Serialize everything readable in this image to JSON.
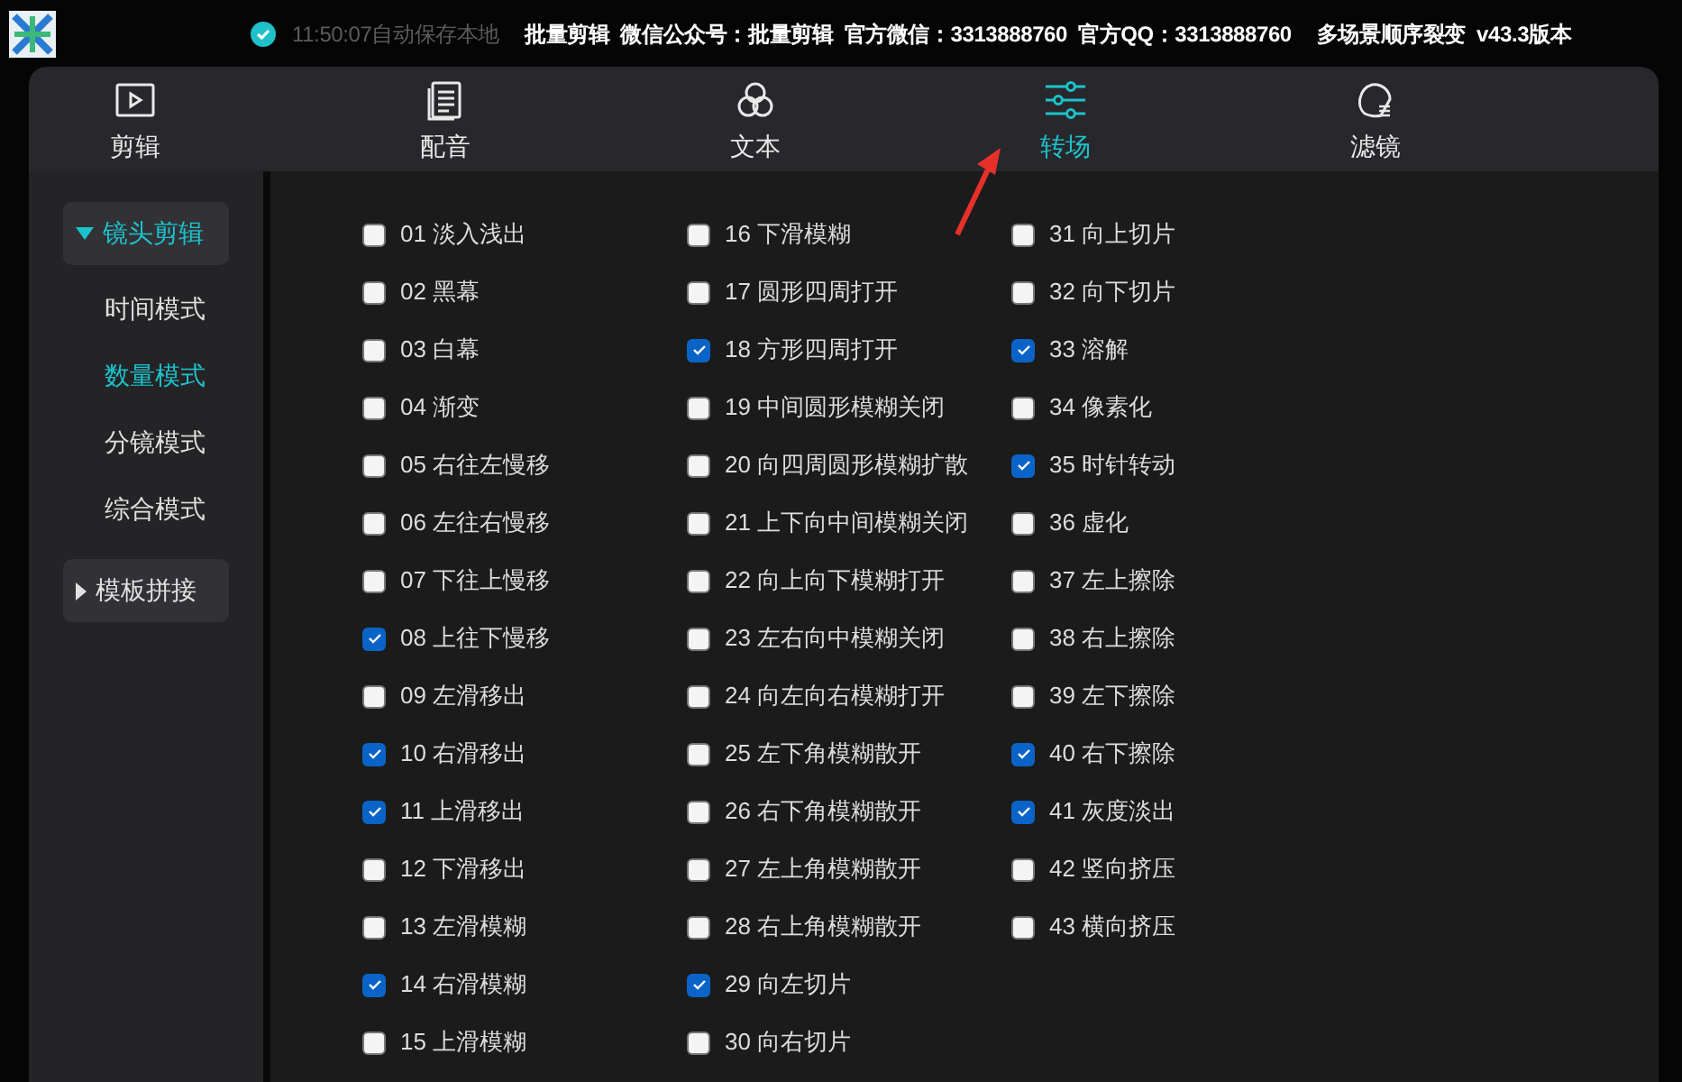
{
  "top_bar": {
    "save_status": "11:50:07自动保存本地",
    "info": [
      "批量剪辑",
      "微信公众号：批量剪辑",
      "官方微信：3313888760",
      "官方QQ：3313888760",
      "多场景顺序裂变",
      "v43.3版本"
    ]
  },
  "tabs": [
    {
      "label": "剪辑",
      "selected": false
    },
    {
      "label": "配音",
      "selected": false
    },
    {
      "label": "文本",
      "selected": false
    },
    {
      "label": "转场",
      "selected": true
    },
    {
      "label": "滤镜",
      "selected": false
    }
  ],
  "sidebar": [
    {
      "label": "镜头剪辑",
      "expanded": true,
      "children": [
        {
          "label": "时间模式",
          "selected": false
        },
        {
          "label": "数量模式",
          "selected": true
        },
        {
          "label": "分镜模式",
          "selected": false
        },
        {
          "label": "综合模式",
          "selected": false
        }
      ]
    },
    {
      "label": "模板拼接",
      "expanded": false
    }
  ],
  "transitions": [
    {
      "label": "01 淡入浅出",
      "checked": false
    },
    {
      "label": "02 黑幕",
      "checked": false
    },
    {
      "label": "03 白幕",
      "checked": false
    },
    {
      "label": "04 渐变",
      "checked": false
    },
    {
      "label": "05 右往左慢移",
      "checked": false
    },
    {
      "label": "06 左往右慢移",
      "checked": false
    },
    {
      "label": "07 下往上慢移",
      "checked": false
    },
    {
      "label": "08 上往下慢移",
      "checked": true
    },
    {
      "label": "09 左滑移出",
      "checked": false
    },
    {
      "label": "10 右滑移出",
      "checked": true
    },
    {
      "label": "11 上滑移出",
      "checked": true
    },
    {
      "label": "12 下滑移出",
      "checked": false
    },
    {
      "label": "13 左滑模糊",
      "checked": false
    },
    {
      "label": "14 右滑模糊",
      "checked": true
    },
    {
      "label": "15 上滑模糊",
      "checked": false
    },
    {
      "label": "16 下滑模糊",
      "checked": false
    },
    {
      "label": "17 圆形四周打开",
      "checked": false
    },
    {
      "label": "18 方形四周打开",
      "checked": true
    },
    {
      "label": "19 中间圆形模糊关闭",
      "checked": false
    },
    {
      "label": "20 向四周圆形模糊扩散",
      "checked": false
    },
    {
      "label": "21 上下向中间模糊关闭",
      "checked": false
    },
    {
      "label": "22 向上向下模糊打开",
      "checked": false
    },
    {
      "label": "23 左右向中模糊关闭",
      "checked": false
    },
    {
      "label": "24 向左向右模糊打开",
      "checked": false
    },
    {
      "label": "25 左下角模糊散开",
      "checked": false
    },
    {
      "label": "26 右下角模糊散开",
      "checked": false
    },
    {
      "label": "27 左上角模糊散开",
      "checked": false
    },
    {
      "label": "28 右上角模糊散开",
      "checked": false
    },
    {
      "label": "29 向左切片",
      "checked": true
    },
    {
      "label": "30 向右切片",
      "checked": false
    },
    {
      "label": "31 向上切片",
      "checked": false
    },
    {
      "label": "32 向下切片",
      "checked": false
    },
    {
      "label": "33 溶解",
      "checked": true
    },
    {
      "label": "34 像素化",
      "checked": false
    },
    {
      "label": "35 时针转动",
      "checked": true
    },
    {
      "label": "36 虚化",
      "checked": false
    },
    {
      "label": "37 左上擦除",
      "checked": false
    },
    {
      "label": "38 右上擦除",
      "checked": false
    },
    {
      "label": "39 左下擦除",
      "checked": false
    },
    {
      "label": "40 右下擦除",
      "checked": true
    },
    {
      "label": "41 灰度淡出",
      "checked": true
    },
    {
      "label": "42 竖向挤压",
      "checked": false
    },
    {
      "label": "43 横向挤压",
      "checked": false
    }
  ]
}
